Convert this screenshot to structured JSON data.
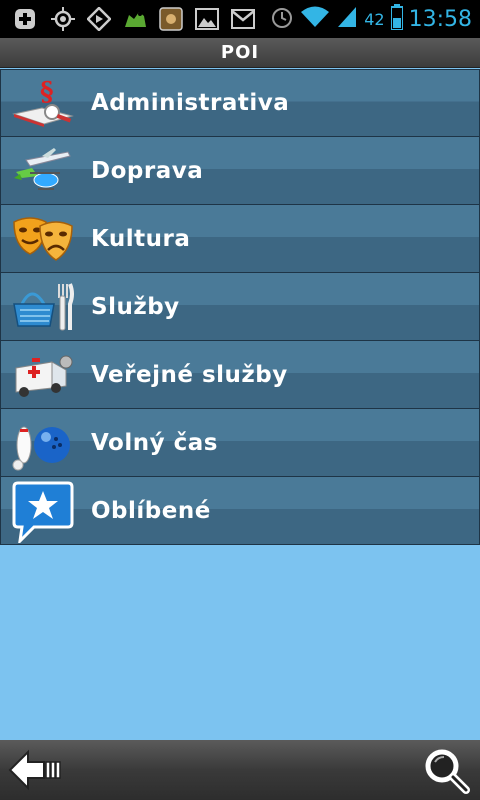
{
  "status_bar": {
    "battery_level": "42",
    "time": "13:58",
    "left_icons": [
      "plus-icon",
      "gps-icon",
      "navigation-icon",
      "android-icon",
      "app-icon",
      "gallery-icon",
      "gmail-icon"
    ],
    "right_icons": [
      "alarm-icon",
      "wifi-icon",
      "signal-icon",
      "battery-icon"
    ]
  },
  "header": {
    "title": "POI"
  },
  "categories": [
    {
      "label": "Administrativa",
      "icon": "administration-icon"
    },
    {
      "label": "Doprava",
      "icon": "transport-icon"
    },
    {
      "label": "Kultura",
      "icon": "theatre-masks-icon"
    },
    {
      "label": "Služby",
      "icon": "basket-cutlery-icon"
    },
    {
      "label": "Veřejné služby",
      "icon": "ambulance-icon"
    },
    {
      "label": "Volný čas",
      "icon": "bowling-icon"
    },
    {
      "label": "Oblíbené",
      "icon": "favorite-star-icon"
    }
  ],
  "bottom_bar": {
    "back_icon": "back-arrow-icon",
    "search_icon": "search-icon"
  },
  "colors": {
    "accent": "#33b5e5",
    "row_light": "#4a7a98",
    "row_dark": "#3d6783",
    "background": "#7cc3f0"
  }
}
